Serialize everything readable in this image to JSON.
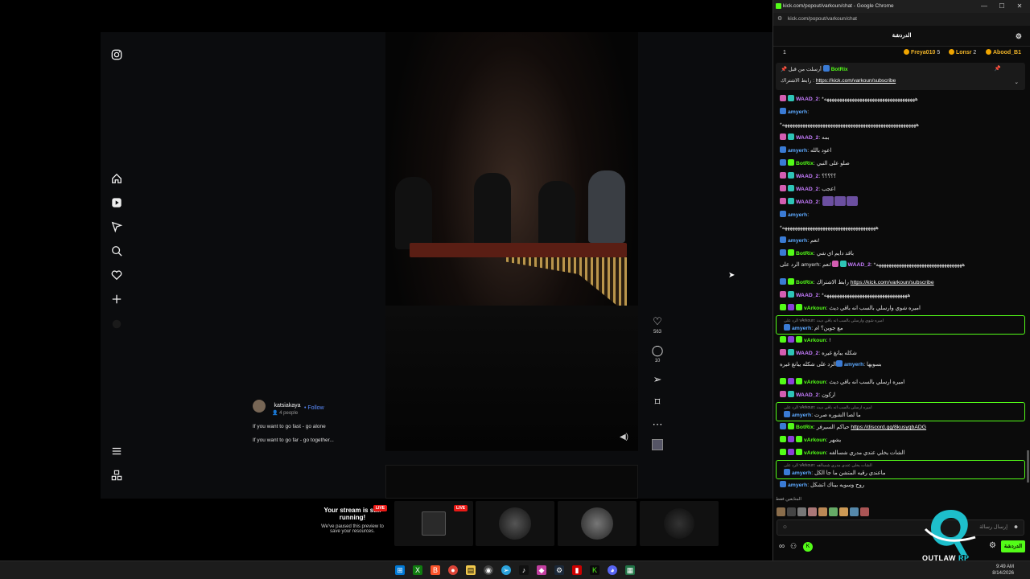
{
  "instagram": {
    "author": "katsiakaya",
    "follow_label": "Follow",
    "people": "4 people",
    "caption_line1": "If you want to go fast - go alone",
    "caption_line2": "If you want to go far - go together...",
    "like_count": "563",
    "comment_count": "10"
  },
  "previews": {
    "paused_title": "Your stream is still running!",
    "paused_sub": "We've paused this preview to save your resources.",
    "live_label": "LIVE"
  },
  "window": {
    "title": "kick.com/popout/varkoun/chat - Google Chrome",
    "url": "kick.com/popout/varkoun/chat",
    "minimize": "—",
    "maximize": "☐",
    "close": "✕"
  },
  "chat": {
    "header": "الدردشة",
    "leaderboard": [
      {
        "rank": "1"
      },
      {
        "name": "Freya010",
        "count": "5"
      },
      {
        "name": "Lonsr",
        "count": "2"
      },
      {
        "name": "Abood_B1",
        "count": ""
      }
    ],
    "pinned": {
      "label": "أرسلت من قبل",
      "user": "BotRix",
      "text": "رابط الاشتراك :",
      "link": "https://kick.com/varkoun/subscribe"
    },
    "messages": [
      {
        "user": "WAAD_2",
        "cls": "u-waad",
        "text": "*ههههههههههههههههههههههههههههههههههههه"
      },
      {
        "user": "amyerh",
        "cls": "u-amy",
        "text": ""
      },
      {
        "user": "",
        "cls": "u-amy",
        "text": "*هههههههههههههههههههههههههههههههههههههههههههههههههههههه"
      },
      {
        "user": "WAAD_2",
        "cls": "u-waad",
        "text": "بمه"
      },
      {
        "user": "amyerh",
        "cls": "u-amy",
        "text": "اعود بالله"
      },
      {
        "user": "BotRix",
        "cls": "u-bot",
        "text": "صلو على النبي"
      },
      {
        "user": "WAAD_2",
        "cls": "u-waad",
        "text": "؟؟؟؟؟"
      },
      {
        "user": "WAAD_2",
        "cls": "u-waad",
        "text": "اعجب"
      },
      {
        "user": "WAAD_2",
        "cls": "u-waad",
        "text": ""
      },
      {
        "user": "amyerh",
        "cls": "u-amy",
        "text": ""
      },
      {
        "user": "",
        "cls": "u-amy",
        "text": "*هههههههههههههههههههههههههههههههههههههه"
      },
      {
        "user": "amyerh",
        "cls": "u-amy",
        "text": "نعم!"
      },
      {
        "user": "BotRix",
        "cls": "u-bot",
        "text": "باقد دايم اي شي"
      },
      {
        "user": "WAAD_2",
        "cls": "u-waad",
        "text": "*ههههههههههههههههههههههههههههههههههه",
        "reply": "الرد على amyerh: نعم!"
      },
      {
        "user": "BotRix",
        "cls": "u-bot",
        "text": "رابط الاشتراك ",
        "link": "https://kick.com/varkoun/subscribe"
      },
      {
        "user": "WAAD_2",
        "cls": "u-waad",
        "text": "*هههههههههههههههههههههههههههههههههه"
      },
      {
        "user": "vArkoun",
        "cls": "u-var",
        "text": "اميره شوي وارسلي بالسب انه باقي ديث"
      },
      {
        "user": "amyerh",
        "cls": "u-amy",
        "text": "مع جوين؟ ام",
        "reply": "الرد على vArkoun: اميره شوي وارسلي بالسب انه باقي ديث",
        "boxed": true
      },
      {
        "user": "vArkoun",
        "cls": "u-var",
        "text": "!"
      },
      {
        "user": "WAAD_2",
        "cls": "u-waad",
        "text": "شكله يبانغ غيره"
      },
      {
        "user": "amyerh",
        "cls": "u-amy",
        "text": "بسويها",
        "reply": "الرد على شكله يبانغ غيره"
      },
      {
        "user": "vArkoun",
        "cls": "u-var",
        "text": "اميره ارسلي بالسب انه باقي ديث"
      },
      {
        "user": "WAAD_2",
        "cls": "u-waad",
        "text": "اركون"
      },
      {
        "user": "amyerh",
        "cls": "u-amy",
        "text": "ما لصا الشوره صرت",
        "reply": "الرد على vArkoun: اميره ارسلي بالسب انه باقي ديث",
        "boxed": true
      },
      {
        "user": "BotRix",
        "cls": "u-bot",
        "text": "حياكم السيرفر ",
        "link": "https://discord.gg/8kusyqbADG"
      },
      {
        "user": "vArkoun",
        "cls": "u-var",
        "text": "يشهر"
      },
      {
        "user": "vArkoun",
        "cls": "u-var",
        "text": "الشات يخلي عندي مدري شسالفه"
      },
      {
        "user": "amyerh",
        "cls": "u-amy",
        "text": "ماعندي رقيه المتشن ما جا الكل",
        "reply": "الرد على vArkoun: الشات يخلي عندي مدري شسالفه",
        "boxed": true
      },
      {
        "user": "amyerh",
        "cls": "u-amy",
        "text": "روح وسويه بيناك اتشكل"
      }
    ],
    "viewers_label": "المتابعين فقط",
    "input_placeholder": "إرسال رسالة",
    "send_label": "الدردشة"
  },
  "taskbar": {
    "time": "9:49 AM",
    "date": "8/14/2026"
  },
  "overlay_logo": {
    "word1": "OUTLAW",
    "word2": "RP"
  },
  "colors": {
    "kick_green": "#53fc18",
    "waad": "#c77dff",
    "amyerh": "#5da9ff",
    "live_red": "#e91916"
  }
}
